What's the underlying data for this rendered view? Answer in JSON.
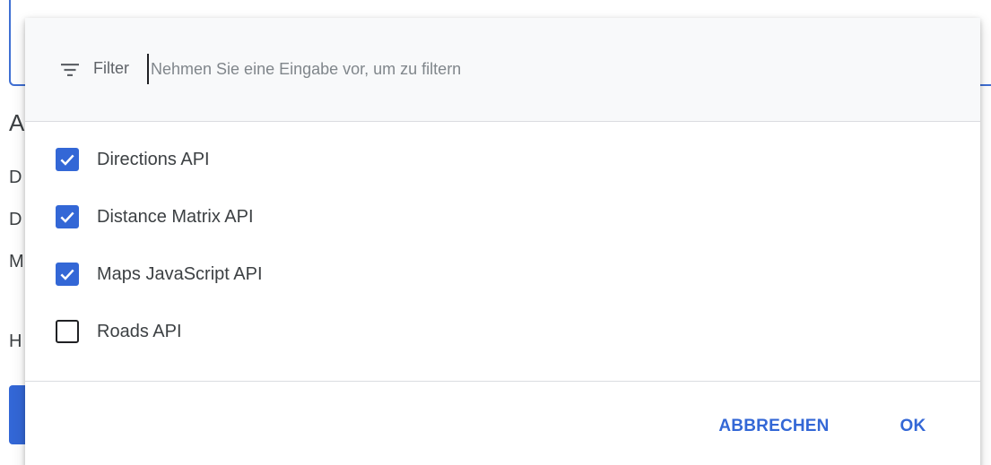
{
  "background": {
    "heading_fragment": "A",
    "lines": [
      "D",
      "D",
      "M",
      "H"
    ]
  },
  "filter": {
    "label": "Filter",
    "placeholder": "Nehmen Sie eine Eingabe vor, um zu filtern",
    "value": ""
  },
  "options": [
    {
      "label": "Directions API",
      "checked": true
    },
    {
      "label": "Distance Matrix API",
      "checked": true
    },
    {
      "label": "Maps JavaScript API",
      "checked": true
    },
    {
      "label": "Roads API",
      "checked": false
    }
  ],
  "actions": {
    "cancel_label": "ABBRECHEN",
    "ok_label": "OK"
  },
  "colors": {
    "accent": "#3367d6",
    "filter_background": "#f8f9fa",
    "divider": "#dadce0"
  },
  "icons": {
    "filter": "filter-list-icon",
    "checkbox_checked": "check-icon"
  }
}
